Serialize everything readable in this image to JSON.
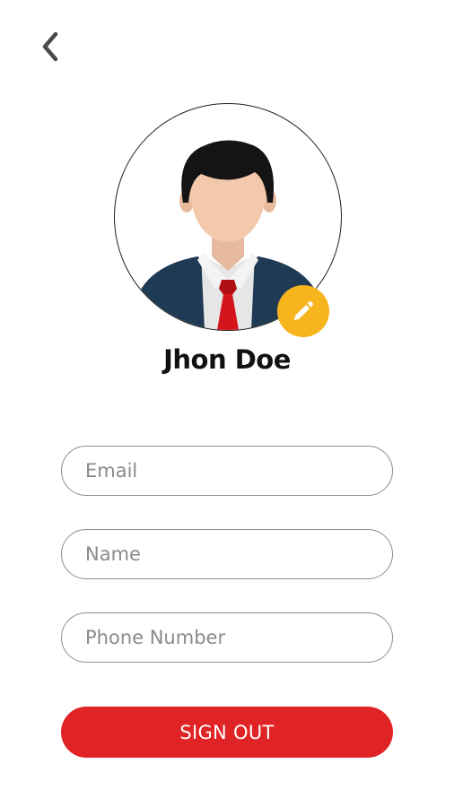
{
  "header": {
    "back_icon": "chevron-left-icon"
  },
  "profile": {
    "avatar_icon": "user-avatar-icon",
    "edit_icon": "pencil-icon",
    "name": "Jhon Doe"
  },
  "form": {
    "email_placeholder": "Email",
    "name_placeholder": "Name",
    "phone_placeholder": "Phone Number"
  },
  "actions": {
    "sign_out_label": "SIGN OUT"
  },
  "colors": {
    "accent_red": "#e02324",
    "edit_badge_yellow": "#f7b51d",
    "suit_navy": "#1f3a54",
    "tie_red": "#d4161c"
  }
}
